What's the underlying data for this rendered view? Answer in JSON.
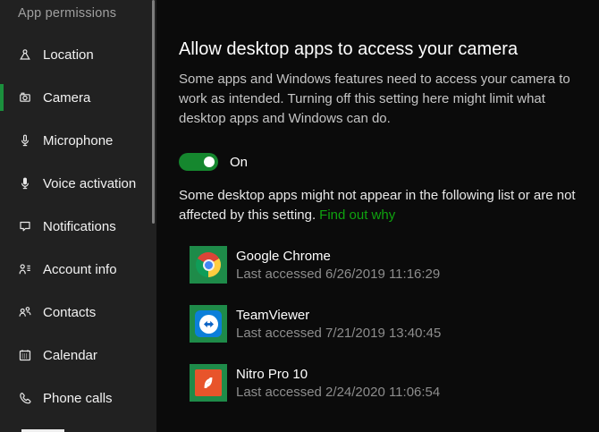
{
  "sidebar": {
    "header": "App permissions",
    "items": [
      {
        "label": "Location"
      },
      {
        "label": "Camera"
      },
      {
        "label": "Microphone"
      },
      {
        "label": "Voice activation"
      },
      {
        "label": "Notifications"
      },
      {
        "label": "Account info"
      },
      {
        "label": "Contacts"
      },
      {
        "label": "Calendar"
      },
      {
        "label": "Phone calls"
      }
    ],
    "selected_item": "Camera"
  },
  "main": {
    "title": "Allow desktop apps to access your camera",
    "description": "Some apps and Windows features need to access your camera to work as intended. Turning off this setting here might limit what desktop apps and Windows can do.",
    "toggle": {
      "label": "On",
      "state": "on"
    },
    "note": "Some desktop apps might not appear in the following list or are not affected by this setting.",
    "note_link": "Find out why",
    "apps": [
      {
        "name": "Google Chrome",
        "last_accessed": "Last accessed 6/26/2019 11:16:29"
      },
      {
        "name": "TeamViewer",
        "last_accessed": "Last accessed 7/21/2019 13:40:45"
      },
      {
        "name": "Nitro Pro 10",
        "last_accessed": "Last accessed 2/24/2020 11:06:54"
      }
    ]
  },
  "colors": {
    "sidebar_bg": "#212121",
    "main_bg": "#0b0b0b",
    "accent_green": "#1b8f3d",
    "toggle_green": "#15872e",
    "link_green": "#0fa30f",
    "tile_green": "#1e8b49"
  }
}
